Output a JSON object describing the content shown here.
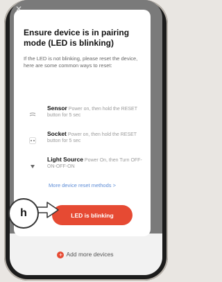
{
  "modal": {
    "title": "Ensure device is in pairing mode (LED is blinking)",
    "description": "If the LED is not blinking, please reset the device, here are some common ways to reset:",
    "methods": [
      {
        "name": "Sensor",
        "text": "Power on, then hold the RESET button for 5 sec",
        "icon": "sensor-icon"
      },
      {
        "name": "Socket",
        "text": "Power on, then hold the RESET button for 5 sec",
        "icon": "socket-icon"
      },
      {
        "name": "Light Source",
        "text": "Power On, then Turn OFF-ON-OFF-ON",
        "icon": "bulb-icon"
      }
    ],
    "more_link": "More device reset methods >",
    "primary_button": "LED is blinking"
  },
  "callout_label": "h",
  "add_more_label": "Add more devices",
  "colors": {
    "accent": "#e64a33",
    "link": "#5b8bd6",
    "overlay": "#7a7a7a"
  }
}
